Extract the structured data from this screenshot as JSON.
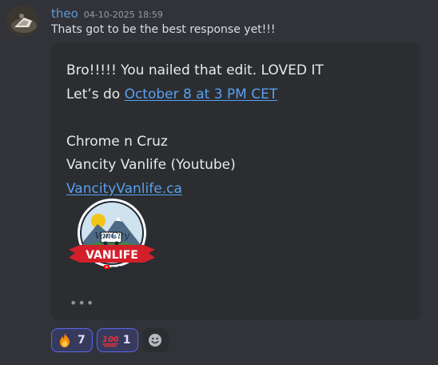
{
  "message": {
    "username": "theo",
    "timestamp": "04-10-2025 18:59",
    "text": "Thats got to be the best response yet!!!",
    "embed": {
      "line1": "Bro!!!!!  You nailed that edit. LOVED IT",
      "line2_prefix": "Let’s do ",
      "line2_link": "October 8 at 3 PM CET",
      "line3": "Chrome n Cruz",
      "line4": "Vancity Vanlife (Youtube)",
      "line5_link": "VancityVanlife.ca",
      "logo": {
        "script_text": "VanCity",
        "banner_text": "VANLIFE",
        "badge_text": "YouTube"
      },
      "more": "•••"
    },
    "reactions": [
      {
        "emoji": "fire-icon",
        "count": "7"
      },
      {
        "emoji": "hundred-points-icon",
        "count": "1"
      }
    ]
  },
  "colors": {
    "background": "#323339",
    "embed_bg": "#2b2d31",
    "username": "#5b9bd5",
    "link": "#5aa0ee",
    "reaction_border": "#5865f2"
  }
}
